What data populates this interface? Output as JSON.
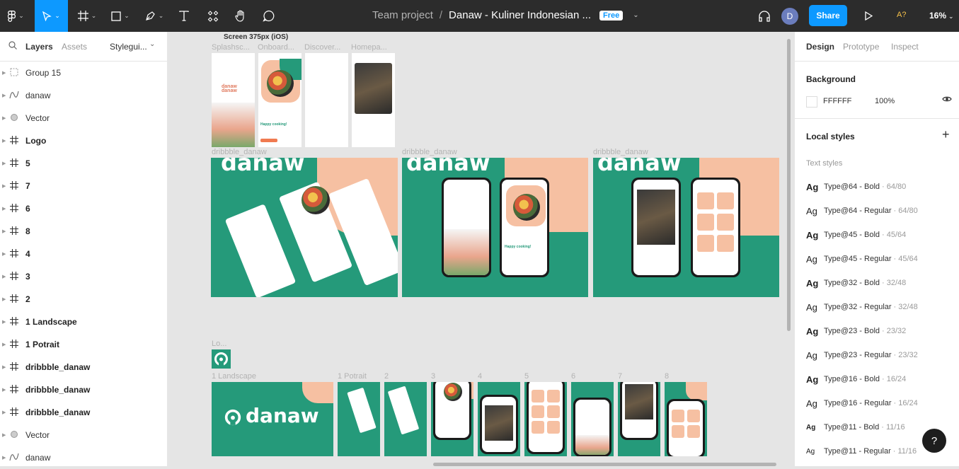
{
  "toolbar": {
    "tools": [
      "figma-menu",
      "move",
      "frame",
      "shape",
      "pen",
      "text",
      "components",
      "hand",
      "comment"
    ],
    "team": "Team project",
    "file": "Danaw - Kuliner Indonesian ...",
    "plan_badge": "Free",
    "avatar_letter": "D",
    "share_label": "Share",
    "a11y_label": "A?",
    "zoom": "16%",
    "accent_color": "#0d99ff"
  },
  "left": {
    "tabs": [
      "Layers",
      "Assets",
      "Styleguide"
    ],
    "styleguide_label": "Stylegui...",
    "layers": [
      {
        "label": "Group 15",
        "icon": "group-icon",
        "bold": false
      },
      {
        "label": "danaw",
        "icon": "vector-path-icon",
        "bold": false
      },
      {
        "label": "Vector",
        "icon": "vector-icon",
        "bold": false
      },
      {
        "label": "Logo",
        "icon": "frame-icon",
        "bold": true
      },
      {
        "label": "5",
        "icon": "frame-icon",
        "bold": true
      },
      {
        "label": "7",
        "icon": "frame-icon",
        "bold": true
      },
      {
        "label": "6",
        "icon": "frame-icon",
        "bold": true
      },
      {
        "label": "8",
        "icon": "frame-icon",
        "bold": true
      },
      {
        "label": "4",
        "icon": "frame-icon",
        "bold": true
      },
      {
        "label": "3",
        "icon": "frame-icon",
        "bold": true
      },
      {
        "label": "2",
        "icon": "frame-icon",
        "bold": true
      },
      {
        "label": "1 Landscape",
        "icon": "frame-icon",
        "bold": true
      },
      {
        "label": "1 Potrait",
        "icon": "frame-icon",
        "bold": true
      },
      {
        "label": "dribbble_danaw",
        "icon": "frame-icon",
        "bold": true
      },
      {
        "label": "dribbble_danaw",
        "icon": "frame-icon",
        "bold": true
      },
      {
        "label": "dribbble_danaw",
        "icon": "frame-icon",
        "bold": true
      },
      {
        "label": "Vector",
        "icon": "vector-icon",
        "bold": false
      },
      {
        "label": "danaw",
        "icon": "vector-path-icon",
        "bold": false
      }
    ]
  },
  "canvas": {
    "section_title": "Screen 375px (iOS)",
    "screen_labels": [
      "Splashsc...",
      "Onboard...",
      "Discover...",
      "Homepa..."
    ],
    "dribbble_label": "dribbble_danaw",
    "logo_label": "Lo...",
    "bottom_labels": [
      "1 Landscape",
      "1 Potrait",
      "2",
      "3",
      "4",
      "5",
      "6",
      "7",
      "8"
    ],
    "brand_word": "danaw",
    "happy_cooking": "Happy cooking!",
    "colors": {
      "green": "#259a7a",
      "peach": "#f6c0a2",
      "orange": "#f07a50"
    }
  },
  "right": {
    "tabs": [
      "Design",
      "Prototype",
      "Inspect"
    ],
    "background_title": "Background",
    "bg_hex": "FFFFFF",
    "bg_opacity": "100%",
    "local_styles_title": "Local styles",
    "text_styles_label": "Text styles",
    "styles": [
      {
        "ag": "Ag",
        "name": "Type@64 - Bold",
        "meta": "· 64/80",
        "bold": true,
        "size": 13
      },
      {
        "ag": "Ag",
        "name": "Type@64 - Regular",
        "meta": "· 64/80",
        "bold": false,
        "size": 13
      },
      {
        "ag": "Ag",
        "name": "Type@45 - Bold",
        "meta": "· 45/64",
        "bold": true,
        "size": 13
      },
      {
        "ag": "Ag",
        "name": "Type@45 - Regular",
        "meta": "· 45/64",
        "bold": false,
        "size": 13
      },
      {
        "ag": "Ag",
        "name": "Type@32 - Bold",
        "meta": "· 32/48",
        "bold": true,
        "size": 13
      },
      {
        "ag": "Ag",
        "name": "Type@32 - Regular",
        "meta": "· 32/48",
        "bold": false,
        "size": 13
      },
      {
        "ag": "Ag",
        "name": "Type@23 - Bold",
        "meta": "· 23/32",
        "bold": true,
        "size": 13
      },
      {
        "ag": "Ag",
        "name": "Type@23 - Regular",
        "meta": "· 23/32",
        "bold": false,
        "size": 13
      },
      {
        "ag": "Ag",
        "name": "Type@16 - Bold",
        "meta": "· 16/24",
        "bold": true,
        "size": 13
      },
      {
        "ag": "Ag",
        "name": "Type@16 - Regular",
        "meta": "· 16/24",
        "bold": false,
        "size": 13
      },
      {
        "ag": "Ag",
        "name": "Type@11 - Bold",
        "meta": "· 11/16",
        "bold": true,
        "size": 10
      },
      {
        "ag": "Ag",
        "name": "Type@11 - Regular",
        "meta": "· 11/16",
        "bold": false,
        "size": 10
      }
    ],
    "help_label": "?"
  }
}
